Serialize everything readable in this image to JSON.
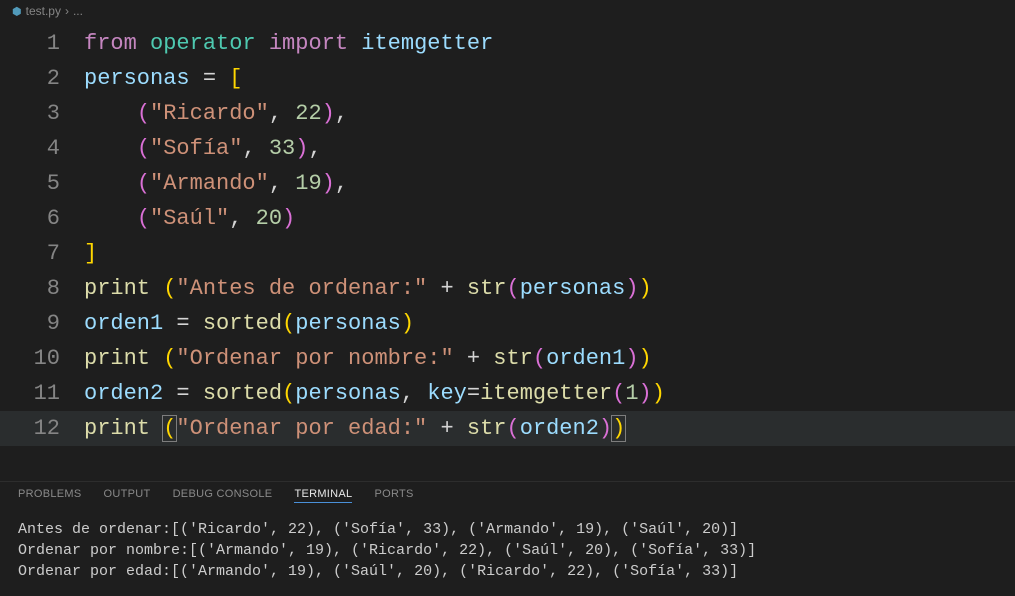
{
  "breadcrumb": {
    "file": "test.py",
    "sep": "›",
    "rest": "..."
  },
  "code": {
    "active_line": 12,
    "lines": [
      {
        "n": "1",
        "tokens": [
          [
            "keyword",
            "from"
          ],
          [
            "punct",
            " "
          ],
          [
            "module",
            "operator"
          ],
          [
            "punct",
            " "
          ],
          [
            "keyword",
            "import"
          ],
          [
            "punct",
            " "
          ],
          [
            "var",
            "itemgetter"
          ]
        ]
      },
      {
        "n": "2",
        "tokens": [
          [
            "var",
            "personas"
          ],
          [
            "punct",
            " "
          ],
          [
            "punct",
            "="
          ],
          [
            "punct",
            " "
          ],
          [
            "bracket-y",
            "["
          ]
        ]
      },
      {
        "n": "3",
        "tokens": [
          [
            "punct",
            "    "
          ],
          [
            "bracket-p",
            "("
          ],
          [
            "string",
            "\"Ricardo\""
          ],
          [
            "punct",
            ", "
          ],
          [
            "number",
            "22"
          ],
          [
            "bracket-p",
            ")"
          ],
          [
            "punct",
            ","
          ]
        ]
      },
      {
        "n": "4",
        "tokens": [
          [
            "punct",
            "    "
          ],
          [
            "bracket-p",
            "("
          ],
          [
            "string",
            "\"Sofía\""
          ],
          [
            "punct",
            ", "
          ],
          [
            "number",
            "33"
          ],
          [
            "bracket-p",
            ")"
          ],
          [
            "punct",
            ","
          ]
        ]
      },
      {
        "n": "5",
        "tokens": [
          [
            "punct",
            "    "
          ],
          [
            "bracket-p",
            "("
          ],
          [
            "string",
            "\"Armando\""
          ],
          [
            "punct",
            ", "
          ],
          [
            "number",
            "19"
          ],
          [
            "bracket-p",
            ")"
          ],
          [
            "punct",
            ","
          ]
        ]
      },
      {
        "n": "6",
        "tokens": [
          [
            "punct",
            "    "
          ],
          [
            "bracket-p",
            "("
          ],
          [
            "string",
            "\"Saúl\""
          ],
          [
            "punct",
            ", "
          ],
          [
            "number",
            "20"
          ],
          [
            "bracket-p",
            ")"
          ]
        ]
      },
      {
        "n": "7",
        "tokens": [
          [
            "bracket-y",
            "]"
          ]
        ]
      },
      {
        "n": "8",
        "tokens": [
          [
            "func",
            "print"
          ],
          [
            "punct",
            " "
          ],
          [
            "bracket-y",
            "("
          ],
          [
            "string",
            "\"Antes de ordenar:\""
          ],
          [
            "punct",
            " "
          ],
          [
            "punct",
            "+"
          ],
          [
            "punct",
            " "
          ],
          [
            "func",
            "str"
          ],
          [
            "bracket-p",
            "("
          ],
          [
            "var",
            "personas"
          ],
          [
            "bracket-p",
            ")"
          ],
          [
            "bracket-y",
            ")"
          ]
        ]
      },
      {
        "n": "9",
        "tokens": [
          [
            "var",
            "orden1"
          ],
          [
            "punct",
            " "
          ],
          [
            "punct",
            "="
          ],
          [
            "punct",
            " "
          ],
          [
            "func",
            "sorted"
          ],
          [
            "bracket-y",
            "("
          ],
          [
            "var",
            "personas"
          ],
          [
            "bracket-y",
            ")"
          ]
        ]
      },
      {
        "n": "10",
        "tokens": [
          [
            "func",
            "print"
          ],
          [
            "punct",
            " "
          ],
          [
            "bracket-y",
            "("
          ],
          [
            "string",
            "\"Ordenar por nombre:\""
          ],
          [
            "punct",
            " "
          ],
          [
            "punct",
            "+"
          ],
          [
            "punct",
            " "
          ],
          [
            "func",
            "str"
          ],
          [
            "bracket-p",
            "("
          ],
          [
            "var",
            "orden1"
          ],
          [
            "bracket-p",
            ")"
          ],
          [
            "bracket-y",
            ")"
          ]
        ]
      },
      {
        "n": "11",
        "tokens": [
          [
            "var",
            "orden2"
          ],
          [
            "punct",
            " "
          ],
          [
            "punct",
            "="
          ],
          [
            "punct",
            " "
          ],
          [
            "func",
            "sorted"
          ],
          [
            "bracket-y",
            "("
          ],
          [
            "var",
            "personas"
          ],
          [
            "punct",
            ", "
          ],
          [
            "param",
            "key"
          ],
          [
            "punct",
            "="
          ],
          [
            "func",
            "itemgetter"
          ],
          [
            "bracket-p",
            "("
          ],
          [
            "number",
            "1"
          ],
          [
            "bracket-p",
            ")"
          ],
          [
            "bracket-y",
            ")"
          ]
        ]
      },
      {
        "n": "12",
        "tokens": [
          [
            "func",
            "print"
          ],
          [
            "punct",
            " "
          ],
          [
            "bracket-y cursor-box",
            "("
          ],
          [
            "string",
            "\"Ordenar por edad:\""
          ],
          [
            "punct",
            " "
          ],
          [
            "punct",
            "+"
          ],
          [
            "punct",
            " "
          ],
          [
            "func",
            "str"
          ],
          [
            "bracket-p",
            "("
          ],
          [
            "var",
            "orden2"
          ],
          [
            "bracket-p",
            ")"
          ],
          [
            "bracket-y cursor-box",
            ")"
          ]
        ]
      }
    ]
  },
  "panel": {
    "tabs": [
      "PROBLEMS",
      "OUTPUT",
      "DEBUG CONSOLE",
      "TERMINAL",
      "PORTS"
    ],
    "active": "TERMINAL"
  },
  "terminal": {
    "lines": [
      "Antes de ordenar:[('Ricardo', 22), ('Sofía', 33), ('Armando', 19), ('Saúl', 20)]",
      "Ordenar por nombre:[('Armando', 19), ('Ricardo', 22), ('Saúl', 20), ('Sofía', 33)]",
      "Ordenar por edad:[('Armando', 19), ('Saúl', 20), ('Ricardo', 22), ('Sofía', 33)]"
    ]
  }
}
